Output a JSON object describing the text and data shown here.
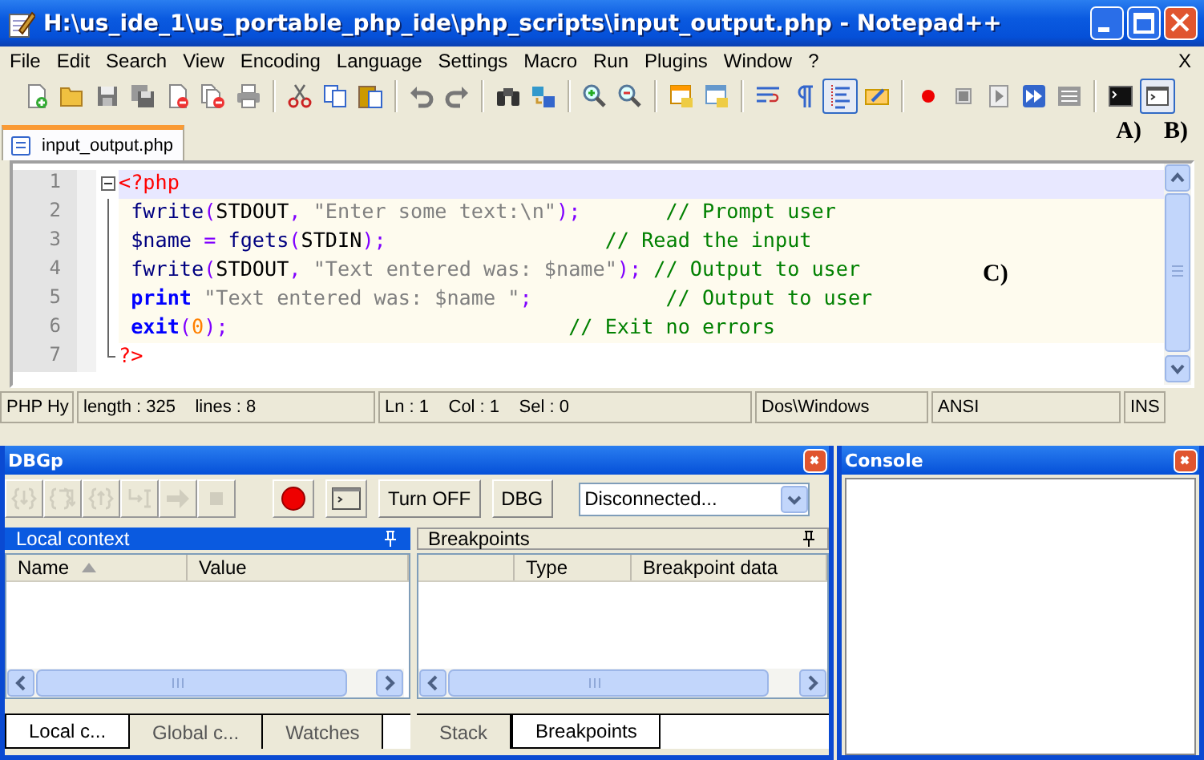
{
  "window": {
    "title": "H:\\us_ide_1\\us_portable_php_ide\\php_scripts\\input_output.php - Notepad++"
  },
  "menu": [
    "File",
    "Edit",
    "Search",
    "View",
    "Encoding",
    "Language",
    "Settings",
    "Macro",
    "Run",
    "Plugins",
    "Window",
    "?"
  ],
  "menu_close": "X",
  "toolbar": [
    {
      "kind": "new",
      "pressed": false
    },
    {
      "kind": "open",
      "pressed": false
    },
    {
      "kind": "save",
      "pressed": false
    },
    {
      "kind": "save-all",
      "pressed": false
    },
    {
      "kind": "close",
      "pressed": false
    },
    {
      "kind": "close-all",
      "pressed": false
    },
    {
      "kind": "print",
      "pressed": false
    },
    {
      "kind": "separator"
    },
    {
      "kind": "cut",
      "pressed": false
    },
    {
      "kind": "copy",
      "pressed": false
    },
    {
      "kind": "paste",
      "pressed": false
    },
    {
      "kind": "separator"
    },
    {
      "kind": "undo",
      "pressed": false
    },
    {
      "kind": "redo",
      "pressed": false
    },
    {
      "kind": "separator"
    },
    {
      "kind": "find",
      "pressed": false
    },
    {
      "kind": "replace",
      "pressed": false
    },
    {
      "kind": "separator"
    },
    {
      "kind": "zoom-in",
      "pressed": false
    },
    {
      "kind": "zoom-out",
      "pressed": false
    },
    {
      "kind": "separator"
    },
    {
      "kind": "sync-v",
      "pressed": false
    },
    {
      "kind": "sync-h",
      "pressed": false
    },
    {
      "kind": "separator"
    },
    {
      "kind": "wrap",
      "pressed": false
    },
    {
      "kind": "show-all",
      "pressed": false
    },
    {
      "kind": "indent",
      "pressed": true
    },
    {
      "kind": "user-lang",
      "pressed": false
    },
    {
      "kind": "separator"
    },
    {
      "kind": "record",
      "pressed": false
    },
    {
      "kind": "stop",
      "pressed": false
    },
    {
      "kind": "play",
      "pressed": false
    },
    {
      "kind": "play-multi",
      "pressed": false
    },
    {
      "kind": "save-macro",
      "pressed": false
    },
    {
      "kind": "separator"
    },
    {
      "kind": "console",
      "pressed": false
    },
    {
      "kind": "console-window",
      "pressed": true
    }
  ],
  "toolbar_labels": [
    "A)",
    "B)"
  ],
  "tabs": [
    {
      "label": "input_output.php",
      "selected": true
    }
  ],
  "editor": {
    "annotation": "C)",
    "lines": [
      {
        "number": "1",
        "current": true,
        "fold_start": true,
        "fold_end": false,
        "tokens": [
          {
            "text": "<?php",
            "kind": "tag"
          }
        ]
      },
      {
        "number": "2",
        "current": false,
        "fold_start": false,
        "fold_end": false,
        "tokens": [
          {
            "text": " fwrite",
            "kind": "func"
          },
          {
            "text": "(",
            "kind": "punct"
          },
          {
            "text": "STDOUT",
            "kind": "const"
          },
          {
            "text": ", ",
            "kind": "punct"
          },
          {
            "text": "\"Enter some text:\\n\"",
            "kind": "string"
          },
          {
            "text": ");",
            "kind": "punct"
          },
          {
            "text": "       // Prompt user",
            "kind": "comment"
          }
        ]
      },
      {
        "number": "3",
        "current": false,
        "fold_start": false,
        "fold_end": false,
        "tokens": [
          {
            "text": " $name",
            "kind": "var"
          },
          {
            "text": " = ",
            "kind": "punct"
          },
          {
            "text": "fgets",
            "kind": "func"
          },
          {
            "text": "(",
            "kind": "punct"
          },
          {
            "text": "STDIN",
            "kind": "const"
          },
          {
            "text": ");",
            "kind": "punct"
          },
          {
            "text": "                  // Read the input",
            "kind": "comment"
          }
        ]
      },
      {
        "number": "4",
        "current": false,
        "fold_start": false,
        "fold_end": false,
        "tokens": [
          {
            "text": " fwrite",
            "kind": "func"
          },
          {
            "text": "(",
            "kind": "punct"
          },
          {
            "text": "STDOUT",
            "kind": "const"
          },
          {
            "text": ", ",
            "kind": "punct"
          },
          {
            "text": "\"Text entered was: $name\"",
            "kind": "string"
          },
          {
            "text": ");",
            "kind": "punct"
          },
          {
            "text": " // Output to user",
            "kind": "comment"
          }
        ]
      },
      {
        "number": "5",
        "current": false,
        "fold_start": false,
        "fold_end": false,
        "tokens": [
          {
            "text": " print",
            "kind": "keyword"
          },
          {
            "text": " \"Text entered was: $name \"",
            "kind": "string"
          },
          {
            "text": ";",
            "kind": "punct"
          },
          {
            "text": "           // Output to user",
            "kind": "comment"
          }
        ]
      },
      {
        "number": "6",
        "current": false,
        "fold_start": false,
        "fold_end": false,
        "tokens": [
          {
            "text": " exit",
            "kind": "keyword"
          },
          {
            "text": "(",
            "kind": "punct"
          },
          {
            "text": "0",
            "kind": "number"
          },
          {
            "text": ");",
            "kind": "punct"
          },
          {
            "text": "                            // Exit no errors",
            "kind": "comment"
          }
        ]
      },
      {
        "number": "7",
        "current": false,
        "fold_start": false,
        "fold_end": true,
        "tokens": [
          {
            "text": "?>",
            "kind": "tag"
          }
        ]
      }
    ]
  },
  "status_bar": [
    "PHP Hy",
    "length : 325    lines : 8",
    "Ln : 1    Col : 1    Sel : 0",
    "Dos\\Windows",
    "ANSI",
    "INS"
  ],
  "debugger": {
    "title": "DBGp",
    "toolbar": [
      {
        "kind": "step-into",
        "disabled": true
      },
      {
        "kind": "step-over",
        "disabled": true
      },
      {
        "kind": "step-out",
        "disabled": true
      },
      {
        "kind": "run-to-cursor",
        "disabled": true
      },
      {
        "kind": "run",
        "disabled": true
      },
      {
        "kind": "stop",
        "disabled": true
      },
      {
        "kind": "record",
        "disabled": false
      },
      {
        "kind": "console",
        "disabled": false
      }
    ],
    "buttons": [
      "Turn OFF",
      "DBG"
    ],
    "connection": {
      "value": "Disconnected..."
    },
    "panes": [
      {
        "kind": "variables",
        "title": "Local context",
        "active": true,
        "columns": [
          {
            "label": "Name",
            "sorted": true
          },
          {
            "label": "Value",
            "sorted": false
          }
        ],
        "tabs": [
          {
            "label": "Local c...",
            "selected": true
          },
          {
            "label": "Global c...",
            "selected": false
          },
          {
            "label": "Watches",
            "selected": false
          }
        ]
      },
      {
        "kind": "breakpoints",
        "title": "Breakpoints",
        "active": false,
        "columns": [
          {
            "label": "Type",
            "sorted": false
          },
          {
            "label": "Breakpoint data",
            "sorted": false
          }
        ],
        "tabs": [
          {
            "label": "Stack",
            "selected": false
          },
          {
            "label": "Breakpoints",
            "selected": true
          }
        ]
      }
    ]
  },
  "console": {
    "title": "Console"
  }
}
